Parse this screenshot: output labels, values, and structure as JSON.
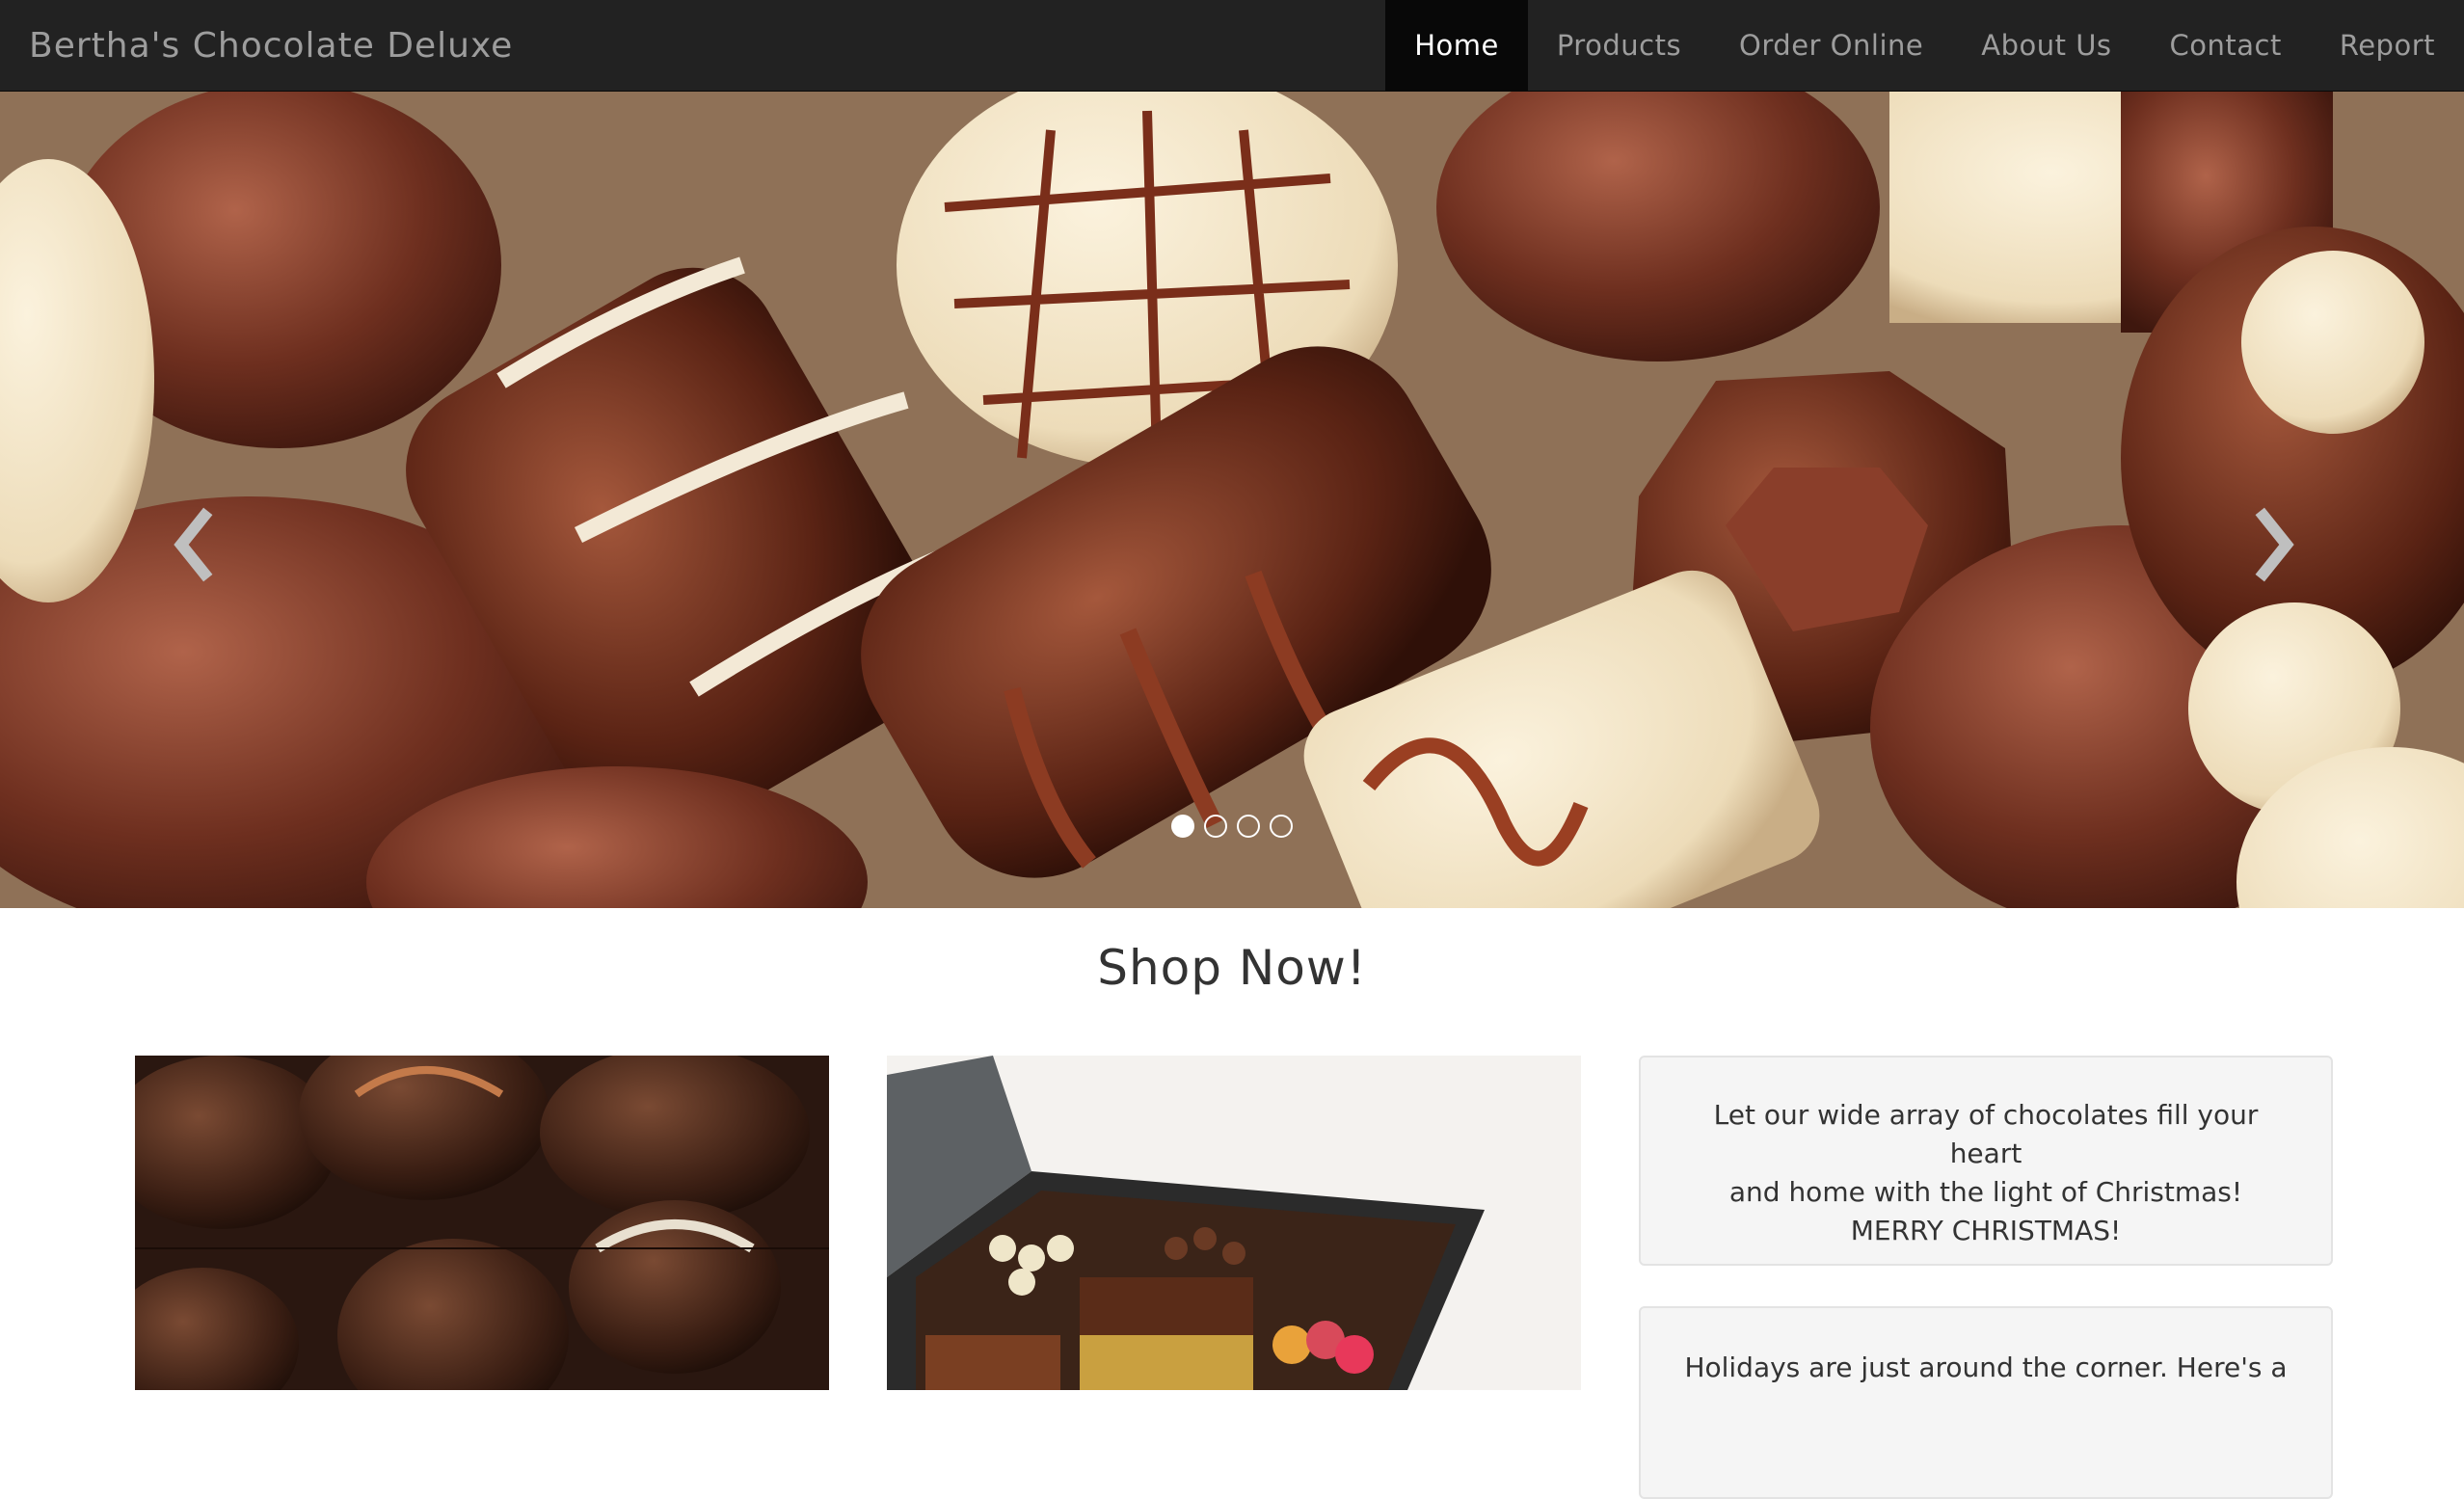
{
  "brand": "Bertha's Chocolate Deluxe",
  "nav": {
    "items": [
      {
        "label": "Home",
        "active": true
      },
      {
        "label": "Products",
        "active": false
      },
      {
        "label": "Order Online",
        "active": false
      },
      {
        "label": "About Us",
        "active": false
      },
      {
        "label": "Contact",
        "active": false
      },
      {
        "label": "Report",
        "active": false
      }
    ]
  },
  "carousel": {
    "slides": 4,
    "active_slide": 1,
    "prev_icon": "chevron-left-icon",
    "next_icon": "chevron-right-icon"
  },
  "shop": {
    "title": "Shop Now!"
  },
  "panels": [
    {
      "lines": [
        "Let our wide array of chocolates fill your heart",
        "and home with the light of Christmas!",
        "MERRY CHRISTMAS!"
      ]
    },
    {
      "lines": [
        "Holidays are just around the corner. Here's a"
      ]
    }
  ],
  "colors": {
    "navbar": "#222222",
    "nav_active": "#080808",
    "nav_text": "#9d9d9d",
    "panel_bg": "#f5f5f5"
  }
}
